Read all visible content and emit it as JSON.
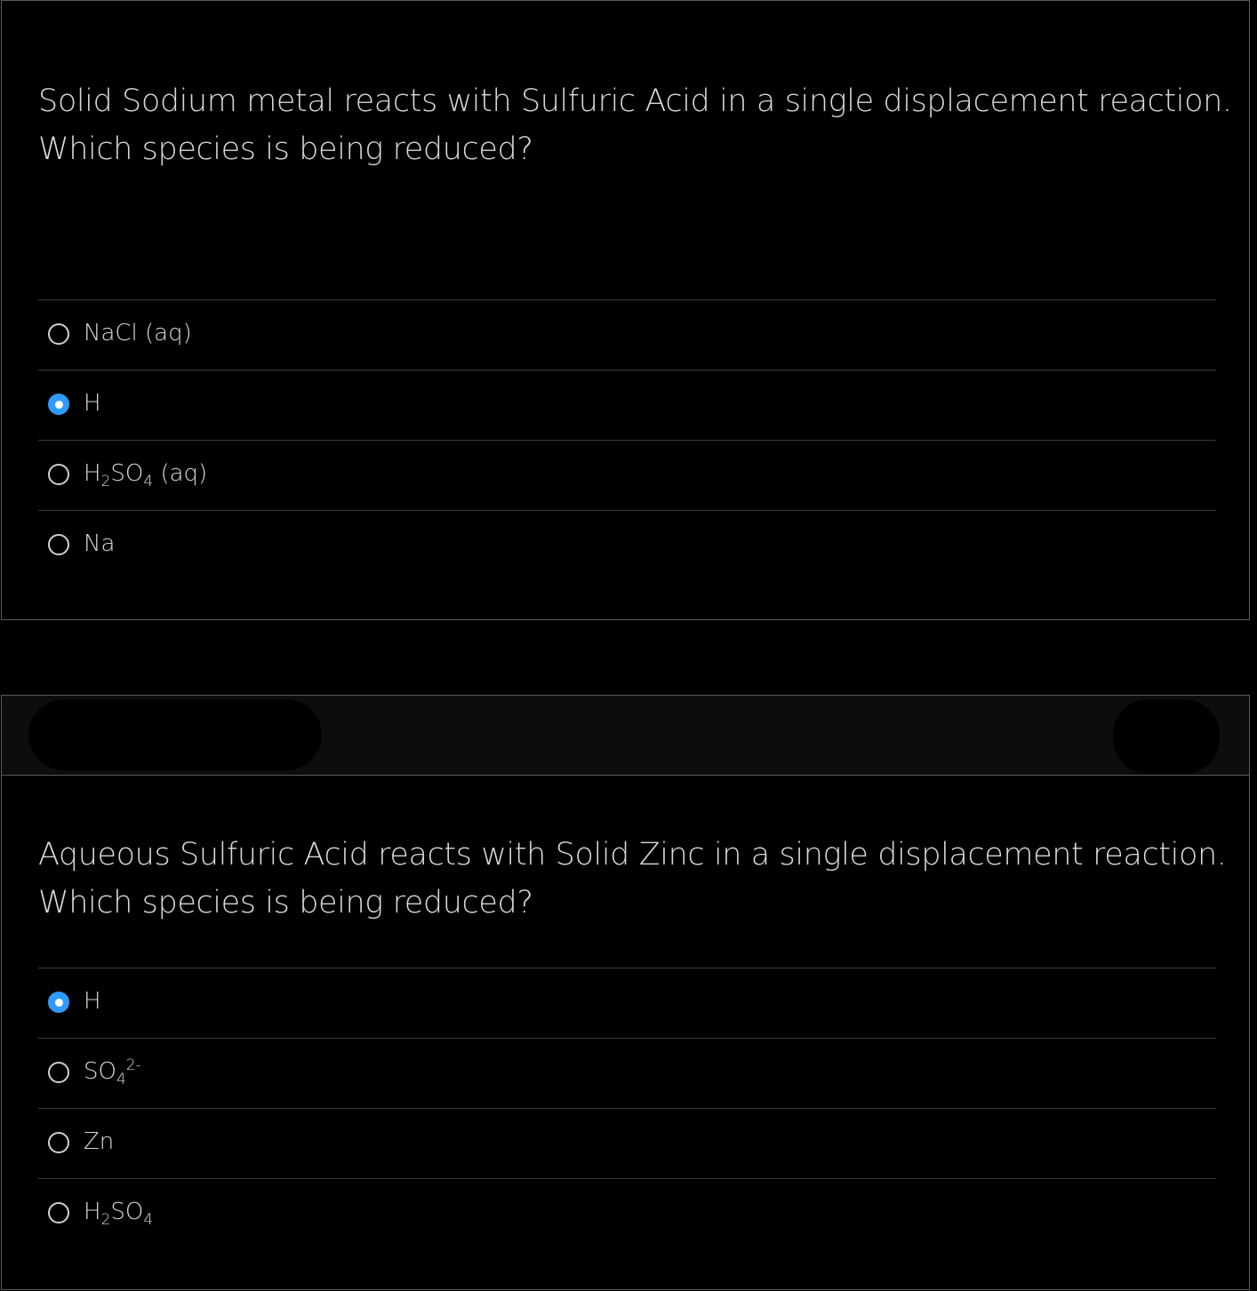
{
  "questions": [
    {
      "prompt_line1": "Solid Sodium metal reacts with Sulfuric Acid in a single displacement reaction.",
      "prompt_line2": "Which species is being reduced?",
      "options": [
        {
          "base": "NaCl (aq)",
          "checked": false
        },
        {
          "base": "H",
          "checked": true
        },
        {
          "p1": "H",
          "sub1": "2",
          "p2": "SO",
          "sub2": "4",
          "p3": " (aq)",
          "checked": false
        },
        {
          "base": "Na",
          "checked": false
        }
      ]
    },
    {
      "prompt_line1": "Aqueous Sulfuric Acid reacts with Solid Zinc in a single displacement reaction.",
      "prompt_line2": "Which species is being reduced?",
      "options": [
        {
          "base": "H",
          "checked": true
        },
        {
          "p1": "SO",
          "sub1": "4",
          "sup1": "2-",
          "checked": false
        },
        {
          "base": "Zn",
          "checked": false
        },
        {
          "p1": "H",
          "sub1": "2",
          "p2": "SO",
          "sub2": "4",
          "checked": false
        }
      ]
    }
  ],
  "colors": {
    "background": "#000000",
    "text": "#d9d9d9",
    "radio_checked": "#2f9bff",
    "border": "#5a5a5a"
  }
}
